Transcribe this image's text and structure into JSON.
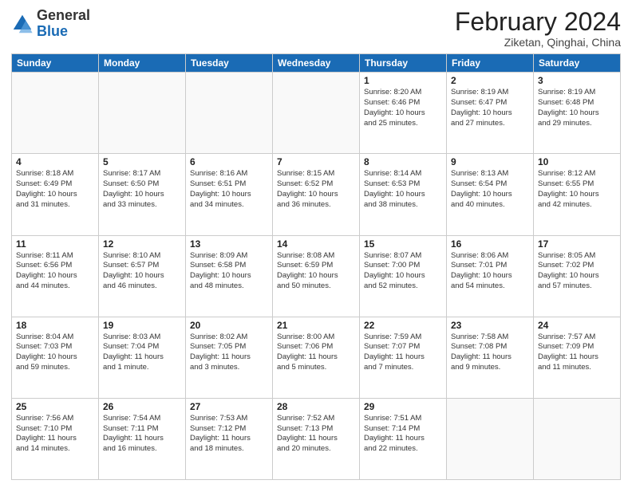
{
  "header": {
    "logo": {
      "general": "General",
      "blue": "Blue"
    },
    "title": "February 2024",
    "subtitle": "Ziketan, Qinghai, China"
  },
  "days_of_week": [
    "Sunday",
    "Monday",
    "Tuesday",
    "Wednesday",
    "Thursday",
    "Friday",
    "Saturday"
  ],
  "weeks": [
    [
      {
        "day": "",
        "info": ""
      },
      {
        "day": "",
        "info": ""
      },
      {
        "day": "",
        "info": ""
      },
      {
        "day": "",
        "info": ""
      },
      {
        "day": "1",
        "info": "Sunrise: 8:20 AM\nSunset: 6:46 PM\nDaylight: 10 hours\nand 25 minutes."
      },
      {
        "day": "2",
        "info": "Sunrise: 8:19 AM\nSunset: 6:47 PM\nDaylight: 10 hours\nand 27 minutes."
      },
      {
        "day": "3",
        "info": "Sunrise: 8:19 AM\nSunset: 6:48 PM\nDaylight: 10 hours\nand 29 minutes."
      }
    ],
    [
      {
        "day": "4",
        "info": "Sunrise: 8:18 AM\nSunset: 6:49 PM\nDaylight: 10 hours\nand 31 minutes."
      },
      {
        "day": "5",
        "info": "Sunrise: 8:17 AM\nSunset: 6:50 PM\nDaylight: 10 hours\nand 33 minutes."
      },
      {
        "day": "6",
        "info": "Sunrise: 8:16 AM\nSunset: 6:51 PM\nDaylight: 10 hours\nand 34 minutes."
      },
      {
        "day": "7",
        "info": "Sunrise: 8:15 AM\nSunset: 6:52 PM\nDaylight: 10 hours\nand 36 minutes."
      },
      {
        "day": "8",
        "info": "Sunrise: 8:14 AM\nSunset: 6:53 PM\nDaylight: 10 hours\nand 38 minutes."
      },
      {
        "day": "9",
        "info": "Sunrise: 8:13 AM\nSunset: 6:54 PM\nDaylight: 10 hours\nand 40 minutes."
      },
      {
        "day": "10",
        "info": "Sunrise: 8:12 AM\nSunset: 6:55 PM\nDaylight: 10 hours\nand 42 minutes."
      }
    ],
    [
      {
        "day": "11",
        "info": "Sunrise: 8:11 AM\nSunset: 6:56 PM\nDaylight: 10 hours\nand 44 minutes."
      },
      {
        "day": "12",
        "info": "Sunrise: 8:10 AM\nSunset: 6:57 PM\nDaylight: 10 hours\nand 46 minutes."
      },
      {
        "day": "13",
        "info": "Sunrise: 8:09 AM\nSunset: 6:58 PM\nDaylight: 10 hours\nand 48 minutes."
      },
      {
        "day": "14",
        "info": "Sunrise: 8:08 AM\nSunset: 6:59 PM\nDaylight: 10 hours\nand 50 minutes."
      },
      {
        "day": "15",
        "info": "Sunrise: 8:07 AM\nSunset: 7:00 PM\nDaylight: 10 hours\nand 52 minutes."
      },
      {
        "day": "16",
        "info": "Sunrise: 8:06 AM\nSunset: 7:01 PM\nDaylight: 10 hours\nand 54 minutes."
      },
      {
        "day": "17",
        "info": "Sunrise: 8:05 AM\nSunset: 7:02 PM\nDaylight: 10 hours\nand 57 minutes."
      }
    ],
    [
      {
        "day": "18",
        "info": "Sunrise: 8:04 AM\nSunset: 7:03 PM\nDaylight: 10 hours\nand 59 minutes."
      },
      {
        "day": "19",
        "info": "Sunrise: 8:03 AM\nSunset: 7:04 PM\nDaylight: 11 hours\nand 1 minute."
      },
      {
        "day": "20",
        "info": "Sunrise: 8:02 AM\nSunset: 7:05 PM\nDaylight: 11 hours\nand 3 minutes."
      },
      {
        "day": "21",
        "info": "Sunrise: 8:00 AM\nSunset: 7:06 PM\nDaylight: 11 hours\nand 5 minutes."
      },
      {
        "day": "22",
        "info": "Sunrise: 7:59 AM\nSunset: 7:07 PM\nDaylight: 11 hours\nand 7 minutes."
      },
      {
        "day": "23",
        "info": "Sunrise: 7:58 AM\nSunset: 7:08 PM\nDaylight: 11 hours\nand 9 minutes."
      },
      {
        "day": "24",
        "info": "Sunrise: 7:57 AM\nSunset: 7:09 PM\nDaylight: 11 hours\nand 11 minutes."
      }
    ],
    [
      {
        "day": "25",
        "info": "Sunrise: 7:56 AM\nSunset: 7:10 PM\nDaylight: 11 hours\nand 14 minutes."
      },
      {
        "day": "26",
        "info": "Sunrise: 7:54 AM\nSunset: 7:11 PM\nDaylight: 11 hours\nand 16 minutes."
      },
      {
        "day": "27",
        "info": "Sunrise: 7:53 AM\nSunset: 7:12 PM\nDaylight: 11 hours\nand 18 minutes."
      },
      {
        "day": "28",
        "info": "Sunrise: 7:52 AM\nSunset: 7:13 PM\nDaylight: 11 hours\nand 20 minutes."
      },
      {
        "day": "29",
        "info": "Sunrise: 7:51 AM\nSunset: 7:14 PM\nDaylight: 11 hours\nand 22 minutes."
      },
      {
        "day": "",
        "info": ""
      },
      {
        "day": "",
        "info": ""
      }
    ]
  ]
}
